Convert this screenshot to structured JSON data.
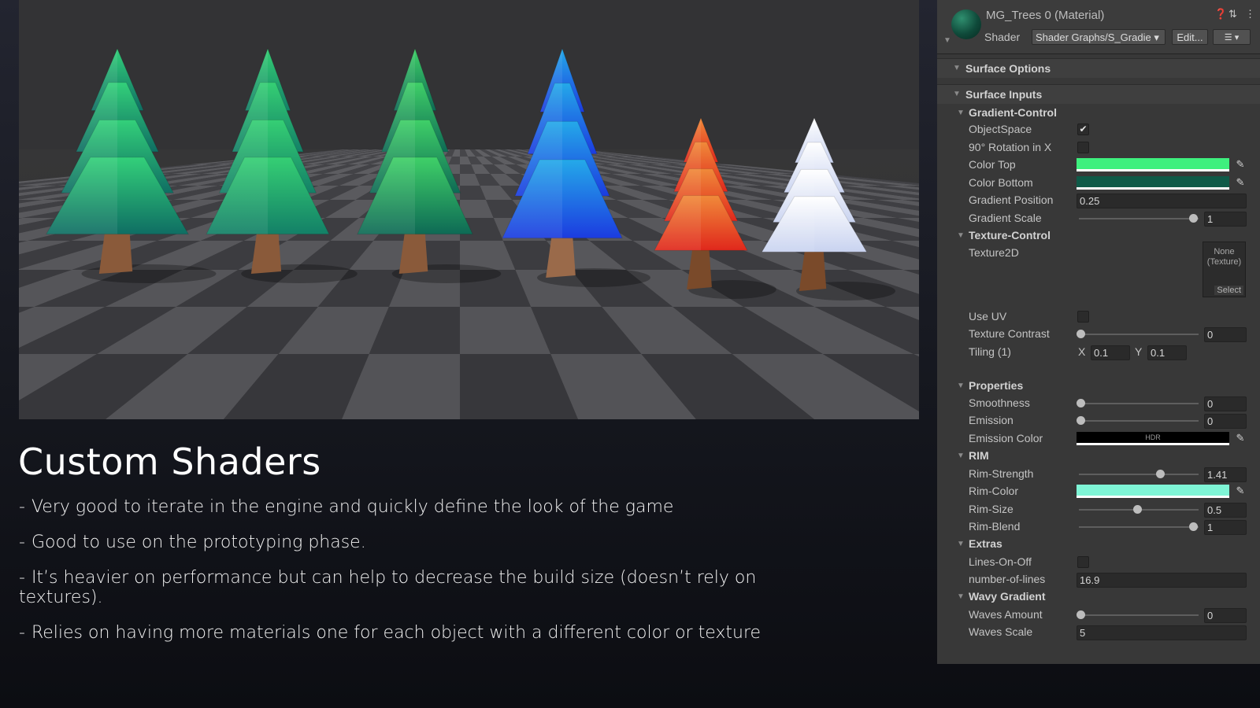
{
  "slide": {
    "title": "Custom Shaders",
    "bullets": [
      "Very good to iterate in the engine and quickly define the look of the game",
      "Good to use on the prototyping phase.",
      "It’s heavier on performance but can help to decrease the build size (doesn’t rely on textures).",
      "Relies on having more materials one for each object with a different color or texture"
    ]
  },
  "inspector": {
    "material_title": "MG_Trees 0 (Material)",
    "shader_label": "Shader",
    "shader_value": "Shader Graphs/S_Gradie",
    "edit_label": "Edit...",
    "sections": {
      "surface_options": "Surface Options",
      "surface_inputs": "Surface Inputs"
    },
    "groups": {
      "gradient_control": "Gradient-Control",
      "texture_control": "Texture-Control",
      "properties": "Properties",
      "rim": "RIM",
      "extras": "Extras",
      "wavy_gradient": "Wavy Gradient"
    },
    "labels": {
      "object_space": "ObjectSpace",
      "rotation_x": "90° Rotation in X",
      "color_top": "Color Top",
      "color_bottom": "Color Bottom",
      "gradient_position": "Gradient Position",
      "gradient_scale": "Gradient Scale",
      "texture2d": "Texture2D",
      "use_uv": "Use UV",
      "texture_contrast": "Texture Contrast",
      "tiling": "Tiling (1)",
      "smoothness": "Smoothness",
      "emission": "Emission",
      "emission_color": "Emission Color",
      "rim_strength": "Rim-Strength",
      "rim_color": "Rim-Color",
      "rim_size": "Rim-Size",
      "rim_blend": "Rim-Blend",
      "lines_on_off": "Lines-On-Off",
      "number_of_lines": "number-of-lines",
      "waves_amount": "Waves Amount",
      "waves_scale": "Waves Scale"
    },
    "values": {
      "object_space_checked": true,
      "rotation_x_checked": false,
      "color_top_hex": "#3ef07e",
      "color_bottom_hex": "#0f5a48",
      "gradient_position": "0.25",
      "gradient_scale": "1",
      "texture_none": "None (Texture)",
      "texture_select": "Select",
      "use_uv_checked": false,
      "texture_contrast": "0",
      "tiling_x_label": "X",
      "tiling_x": "0.1",
      "tiling_y_label": "Y",
      "tiling_y": "0.1",
      "smoothness": "0",
      "emission": "0",
      "emission_color_hex": "#000000",
      "emission_hdr": "HDR",
      "rim_strength": "1.41",
      "rim_color_hex": "#7ff5d6",
      "rim_size": "0.5",
      "rim_blend": "1",
      "lines_on_off_checked": false,
      "number_of_lines": "16.9",
      "waves_amount": "0",
      "waves_scale": "5"
    }
  }
}
